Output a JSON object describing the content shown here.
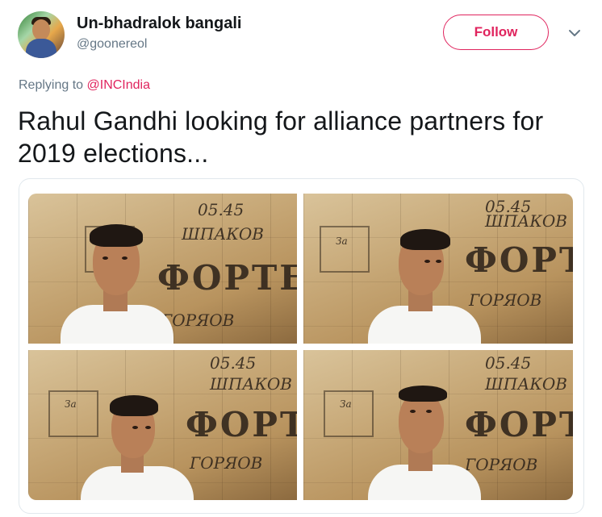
{
  "author": {
    "name": "Un-bhadralok bangali",
    "handle": "@goonereol",
    "avatar_icon": "profile-avatar"
  },
  "actions": {
    "follow_label": "Follow",
    "more_icon": "chevron-down-icon"
  },
  "reply": {
    "prefix": "Replying to ",
    "mention": "@INCIndia"
  },
  "tweet": {
    "text": "Rahul Gandhi looking for alliance partners for 2019 elections..."
  },
  "media": {
    "photo_count": 4,
    "wall_text": {
      "big": "ФОРТЕ",
      "mid": "ШПАКОВ",
      "low": "ГОРЯОВ",
      "date": "05.45",
      "note": "За"
    }
  },
  "colors": {
    "accent": "#e0245e",
    "text": "#14171a",
    "muted": "#657786",
    "border": "#e1e8ed"
  }
}
